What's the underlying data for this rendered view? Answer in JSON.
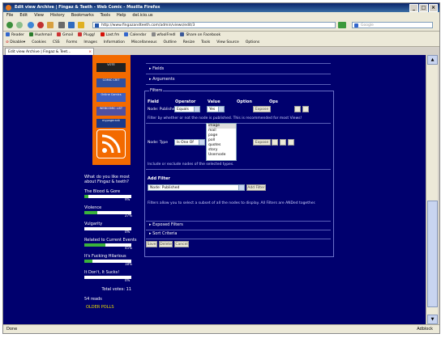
{
  "window": {
    "title": "Edit view Archive | Fingaz & Teeth - Web Comic - Mozilla Firefox"
  },
  "menu": [
    "File",
    "Edit",
    "View",
    "History",
    "Bookmarks",
    "Tools",
    "Help",
    "del.icio.us"
  ],
  "address": {
    "url": "http://www.fingazandteeth.com/admin/views/edit/3"
  },
  "search": {
    "placeholder": "Google"
  },
  "bookmarks": [
    "Reader",
    "Hushmail",
    "Gmail",
    "Plugg!",
    "Last.fm",
    "Calendar",
    "wfoolFredl",
    "Share on Facebook"
  ],
  "webdev": [
    "Disable",
    "Cookies",
    "CSS",
    "Forms",
    "Images",
    "Information",
    "Miscellaneous",
    "Outline",
    "Resize",
    "Tools",
    "View Source",
    "Options"
  ],
  "tab": {
    "label": "Edit view Archive | Fingaz & Teet..."
  },
  "status": {
    "left": "Done",
    "right": "Adblock"
  },
  "sidebar": {
    "badges": [
      "VOTE",
      "COMIC CRIT",
      "Online Comics",
      "WEBCOMIC LIST",
      "mypagerank"
    ],
    "poll": {
      "question": "What do you like most about Fingaz & teeth?",
      "options": [
        {
          "label": "The Blood & Gore",
          "percent": "9%",
          "fill": 0.09
        },
        {
          "label": "Violence",
          "percent": "27%",
          "fill": 0.27
        },
        {
          "label": "Vulgarity",
          "percent": "0%",
          "fill": 0
        },
        {
          "label": "Related to Current Events",
          "percent": "45%",
          "fill": 0.45
        },
        {
          "label": "It's Fucking Hilarious",
          "percent": "18%",
          "fill": 0.18
        },
        {
          "label": "It Don't, It Sucks!",
          "percent": "0%",
          "fill": 0
        }
      ],
      "total": "Total votes: 11",
      "reads": "54 reads",
      "block": "OLDER POLLS"
    }
  },
  "main": {
    "fields": "Fields",
    "arguments": "Arguments",
    "filters_legend": "Filters",
    "headers": {
      "field": "Field",
      "operator": "Operator",
      "value": "Value",
      "option": "Option",
      "ops": "Ops"
    },
    "row1": {
      "field": "Node: Published",
      "operator": "Equals",
      "value": "Yes",
      "expose": "Expose",
      "desc": "Filter by whether or not the node is published. This is recommended for most Views!"
    },
    "row2": {
      "field": "Node: Type",
      "operator": "Is One Of",
      "expose": "Expose",
      "desc": "Include or exclude nodes of the selected types.",
      "options": [
        "image",
        "mail",
        "page",
        "poll",
        "quotes",
        "story",
        "Usernode"
      ]
    },
    "add_filter": {
      "heading": "Add Filter",
      "select": "Node: Published",
      "button": "Add Filter",
      "help": "Filters allow you to select a subset of all the nodes to display. All Filters are ANDed together."
    },
    "exposed": "Exposed Filters",
    "sort": "Sort Criteria",
    "actions": [
      "Save",
      "Delete",
      "Cancel"
    ]
  }
}
